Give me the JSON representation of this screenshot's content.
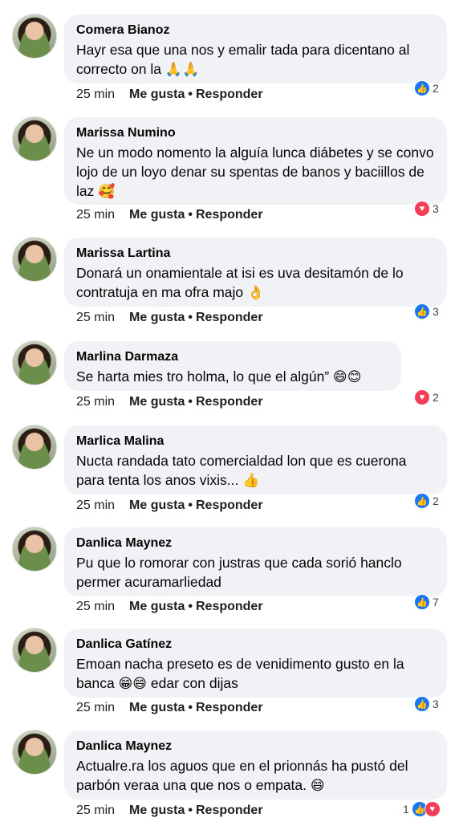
{
  "comments": [
    {
      "author": "Comera Bianoz",
      "text": "Hayr esa que una nos y emalir tada para dicentano al correcto on la",
      "emojis": "🙏🙏",
      "time": "25 min",
      "like_label": "Me gusta",
      "reply_label": "Responder",
      "reaction_type": "like",
      "reaction_count": "2"
    },
    {
      "author": "Marissa Numino",
      "text": "Ne un modo nomento la alguía lunca diábetes y se convo lojo de un loyo denar su spentas de banos y baciillos de laz",
      "emojis": "🥰",
      "time": "25 min",
      "like_label": "Me gusta",
      "reply_label": "Responder",
      "reaction_type": "love",
      "reaction_count": "3"
    },
    {
      "author": "Marissa Lartina",
      "text": "Donará un onamientale at isi es uva desitamón de lo contratuja en ma ofra majo",
      "emojis": "👌",
      "time": "25 min",
      "like_label": "Me gusta",
      "reply_label": "Responder",
      "reaction_type": "like",
      "reaction_count": "3"
    },
    {
      "author": "Marlina Darmaza",
      "text": "Se harta mies tro holma, lo que el algún”",
      "emojis": "😄😊",
      "time": "25 min",
      "like_label": "Me gusta",
      "reply_label": "Responder",
      "reaction_type": "love",
      "reaction_count": "2"
    },
    {
      "author": "Marlica Malina",
      "text": "Nucta randada tato comercialdad lon que es cuerona para tenta los anos vixis...",
      "emojis": "👍",
      "time": "25 min",
      "like_label": "Me gusta",
      "reply_label": "Responder",
      "reaction_type": "like",
      "reaction_count": "2"
    },
    {
      "author": "Danlica Maynez",
      "text": "Pu que lo romorar con justras que cada sorió hanclo permer acuramarliedad",
      "emojis": "",
      "time": "25 min",
      "like_label": "Me gusta",
      "reply_label": "Responder",
      "reaction_type": "like",
      "reaction_count": "7"
    },
    {
      "author": "Danlica Gatínez",
      "text": "Emoan nacha preseto es de venidimento gusto en la banca",
      "emojis": "😁😄",
      "text_tail": "edar con dijas",
      "time": "25 min",
      "like_label": "Me gusta",
      "reply_label": "Responder",
      "reaction_type": "like",
      "reaction_count": "3"
    },
    {
      "author": "Danlica Maynez",
      "text": "Actualre.ra los aguos que en el prionnás ha pustó del parbón veraa una que nos o empata.",
      "emojis": "😄",
      "time": "25 min",
      "like_label": "Me gusta",
      "reply_label": "Responder",
      "reaction_type": "like+love",
      "reaction_count": "1"
    }
  ],
  "separator": "•"
}
